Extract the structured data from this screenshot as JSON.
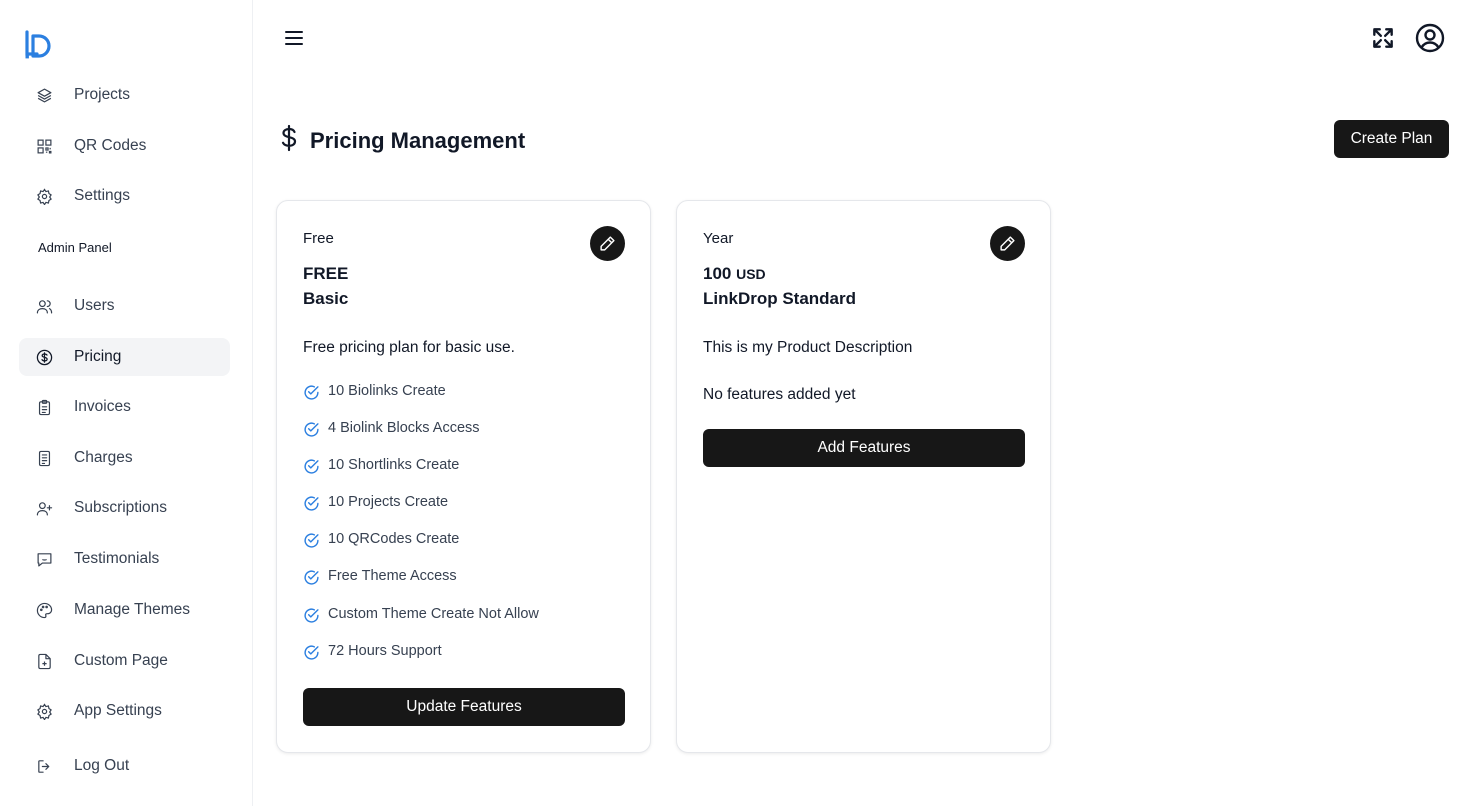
{
  "sidebar": {
    "logo_icon": "linkdrop-logo-icon",
    "items_top": [
      {
        "label": "Projects",
        "icon": "layers-icon"
      },
      {
        "label": "QR Codes",
        "icon": "qr-code-icon"
      },
      {
        "label": "Settings",
        "icon": "gear-icon"
      }
    ],
    "section_label": "Admin Panel",
    "items_admin": [
      {
        "label": "Users",
        "icon": "users-icon"
      },
      {
        "label": "Pricing",
        "icon": "dollar-circle-icon",
        "active": true
      },
      {
        "label": "Invoices",
        "icon": "clipboard-icon"
      },
      {
        "label": "Charges",
        "icon": "receipt-icon"
      },
      {
        "label": "Subscriptions",
        "icon": "user-plus-icon"
      },
      {
        "label": "Testimonials",
        "icon": "message-icon"
      },
      {
        "label": "Manage Themes",
        "icon": "palette-icon"
      },
      {
        "label": "Custom Page",
        "icon": "file-plus-icon"
      },
      {
        "label": "App Settings",
        "icon": "gear-icon"
      },
      {
        "label": "Log Out",
        "icon": "logout-icon"
      }
    ]
  },
  "header": {
    "menu_icon": "hamburger-icon",
    "fullscreen_icon": "expand-icon",
    "account_icon": "user-circle-icon"
  },
  "page": {
    "title": "Pricing Management",
    "title_icon": "dollar-icon",
    "create_button": "Create Plan"
  },
  "plans": [
    {
      "period": "Free",
      "price": "FREE",
      "currency": "",
      "name": "Basic",
      "description": "Free pricing plan for basic use.",
      "features": [
        "10 Biolinks Create",
        "4 Biolink Blocks Access",
        "10 Shortlinks Create",
        "10 Projects Create",
        "10 QRCodes Create",
        "Free Theme Access",
        "Custom Theme Create Not Allow",
        "72 Hours Support"
      ],
      "empty_text": "",
      "button": "Update Features"
    },
    {
      "period": "Year",
      "price": "100",
      "currency": "USD",
      "name": "LinkDrop Standard",
      "description": "This is my Product Description",
      "features": [],
      "empty_text": "No features added yet",
      "button": "Add Features"
    }
  ],
  "colors": {
    "accent_blue": "#2b7fe0",
    "button_dark": "#171717",
    "active_bg": "#f3f4f6"
  }
}
